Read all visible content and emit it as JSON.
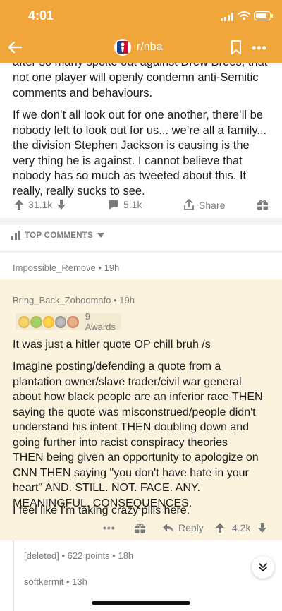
{
  "status_bar": {
    "time": "4:01"
  },
  "navbar": {
    "subreddit": "r/nba",
    "more_label": "•••"
  },
  "post": {
    "clipped_line": "after so many spoke out against Drew Brees, that",
    "lines_para1": [
      "not one player will openly condemn anti-Semitic",
      "comments and behaviours."
    ],
    "lines_para2": [
      "If we don’t all look out for one another, there’ll be",
      "nobody left to look out for us... we’re all a family...",
      "the division Stephen Jackson is causing is the",
      "very thing he is against. I cannot believe that",
      "nobody has so much as tweeted about this. It",
      "really, really sucks to see."
    ],
    "upvotes": "31.1k",
    "comments": "5.1k",
    "share_label": "Share"
  },
  "sort": {
    "label": "TOP COMMENTS"
  },
  "comments": [
    {
      "author": "Impossible_Remove",
      "age": "19h"
    },
    {
      "author": "Bring_Back_Zoboomafo",
      "age": "19h",
      "awards_label": "9 Awards",
      "para1": "It was just a hitler quote OP chill bruh /s",
      "para2_lines": [
        "Imagine posting/defending a quote from a",
        "plantation owner/slave trader/civil war general",
        "about how black people are an inferior race THEN",
        "saying the quote was misconstrued/people didn't",
        "understand his intent THEN doubling down and",
        "going further into racist conspiracy theories",
        "THEN being given an opportunity to apologize on",
        "CNN THEN saying \"you don't have hate in your",
        "heart\" AND. STILL. NOT. FACE. ANY.",
        "MEANINGFUL. CONSEQUENCES."
      ],
      "para3": "I feel like I'm taking crazy pills here.",
      "more_label": "•••",
      "reply_label": "Reply",
      "score": "4.2k"
    },
    {
      "author": "[deleted]",
      "points": "622 points",
      "age": "18h"
    },
    {
      "author": "softkermit",
      "age": "13h"
    }
  ],
  "colors": {
    "header": "#f0a63a",
    "highlight": "#fbf3dd",
    "meta": "#7c7c7c"
  },
  "icons": [
    "back-arrow-icon",
    "nba-logo-icon",
    "bookmark-icon",
    "upvote-icon",
    "downvote-icon",
    "comment-icon",
    "share-icon",
    "gift-icon",
    "reply-icon",
    "collapse-icon"
  ]
}
